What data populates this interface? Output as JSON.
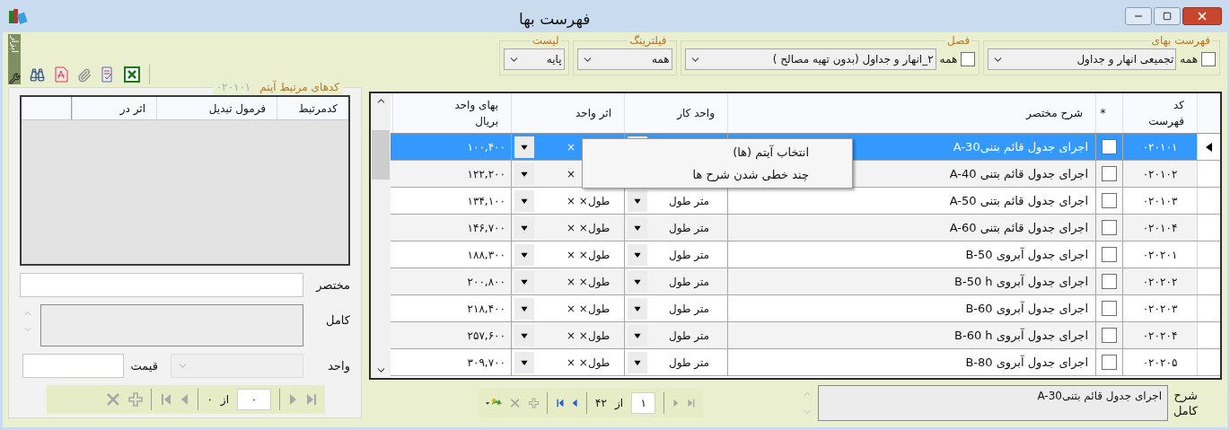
{
  "window": {
    "title": "فهرست بها"
  },
  "toolbar": {
    "label": "ابزار"
  },
  "filters": [
    {
      "label": "فهرست بهای",
      "all_label": "همه",
      "all_checked": false,
      "value": "تجمیعی انهار و جداول"
    },
    {
      "label": "فصل",
      "all_label": "همه",
      "all_checked": false,
      "value": "۲_انهار و جداول (بدون تهیه مصالح  )"
    },
    {
      "label": "فیلترینگ",
      "value": "همه"
    },
    {
      "label": "لیست",
      "value": "پایه"
    }
  ],
  "related": {
    "title": "کدهای مرتبط آیتم",
    "code": "۰۲۰۱۰۱",
    "columns": [
      "کدمرتبط",
      "فرمول تبدیل",
      "اثر در"
    ],
    "fields": {
      "short_label": "مختصر",
      "full_label": "کامل",
      "unit_label": "واحد",
      "price_label": "قیمت"
    },
    "nav": {
      "items": [
        {
          "kind": "last",
          "disabled": true
        },
        {
          "kind": "next",
          "disabled": true
        },
        {
          "kind": "position",
          "text": "۰"
        },
        {
          "kind": "of",
          "text": "از"
        },
        {
          "kind": "total",
          "text": "۰"
        },
        {
          "kind": "prev",
          "disabled": true
        },
        {
          "kind": "first",
          "disabled": true
        },
        {
          "kind": "add",
          "disabled": true
        },
        {
          "kind": "delete",
          "disabled": true
        }
      ]
    }
  },
  "table": {
    "columns": [
      "کد\nفهرست",
      "*",
      "شرح مختصر",
      "واحد کار",
      "اثر واحد",
      "بهای واحد\nبریال"
    ],
    "rows": [
      {
        "code": "۰۲۰۱۰۱",
        "checked": false,
        "description": "اجرای جدول قائم بتنیA-30",
        "effect": "×",
        "price": "۱۰۰,۴۰۰",
        "selected": true
      },
      {
        "code": "۰۲۰۱۰۲",
        "checked": false,
        "description": "اجرای جدول قائم بتنی A-40",
        "effect": "×",
        "price": "۱۲۲,۲۰۰",
        "selected": false
      },
      {
        "code": "۰۲۰۱۰۳",
        "checked": false,
        "description": "اجرای جدول قائم بتنی A-50",
        "unit": "متر طول",
        "effect": "طول× ×",
        "price": "۱۳۴,۱۰۰",
        "selected": false
      },
      {
        "code": "۰۲۰۱۰۴",
        "checked": false,
        "description": "اجرای جدول قائم بتنی A-60",
        "unit": "متر طول",
        "effect": "طول× ×",
        "price": "۱۴۶,۷۰۰",
        "selected": false
      },
      {
        "code": "۰۲۰۲۰۱",
        "checked": false,
        "description": "اجرای جدول آبروی B-50",
        "unit": "متر طول",
        "effect": "طول× ×",
        "price": "۱۸۸,۳۰۰",
        "selected": false
      },
      {
        "code": "۰۲۰۲۰۲",
        "checked": false,
        "description": "اجرای جدول آبروی B-50 h",
        "unit": "متر طول",
        "effect": "طول× ×",
        "price": "۲۰۰,۸۰۰",
        "selected": false
      },
      {
        "code": "۰۲۰۲۰۳",
        "checked": false,
        "description": "اجرای جدول آبروی B-60",
        "unit": "متر طول",
        "effect": "طول× ×",
        "price": "۲۱۸,۴۰۰",
        "selected": false
      },
      {
        "code": "۰۲۰۲۰۴",
        "checked": false,
        "description": "اجرای جدول آبروی B-60 h",
        "unit": "متر طول",
        "effect": "طول× ×",
        "price": "۲۵۷,۶۰۰",
        "selected": false
      },
      {
        "code": "۰۲۰۲۰۵",
        "checked": false,
        "description": "اجرای جدول آبروی B-80",
        "unit": "متر طول",
        "effect": "طول× ×",
        "price": "۳۰۹,۷۰۰",
        "selected": false
      }
    ]
  },
  "context_menu": {
    "items": [
      "انتخاب آیتم (ها)",
      "چند خطی شدن شرح ها"
    ]
  },
  "nav": {
    "items": [
      {
        "kind": "last",
        "disabled": true
      },
      {
        "kind": "next",
        "disabled": true
      },
      {
        "kind": "position",
        "text": "۱"
      },
      {
        "kind": "of",
        "text": "از"
      },
      {
        "kind": "total",
        "text": "۴۲"
      },
      {
        "kind": "prev",
        "disabled": false
      },
      {
        "kind": "first",
        "disabled": false
      },
      {
        "kind": "add",
        "disabled": true
      },
      {
        "kind": "delete",
        "disabled": true
      },
      {
        "kind": "refresh",
        "disabled": false
      }
    ]
  },
  "full_description": {
    "label": "شرح\nکامل",
    "value": "اجرای جدول قائم بتنیA-30"
  }
}
